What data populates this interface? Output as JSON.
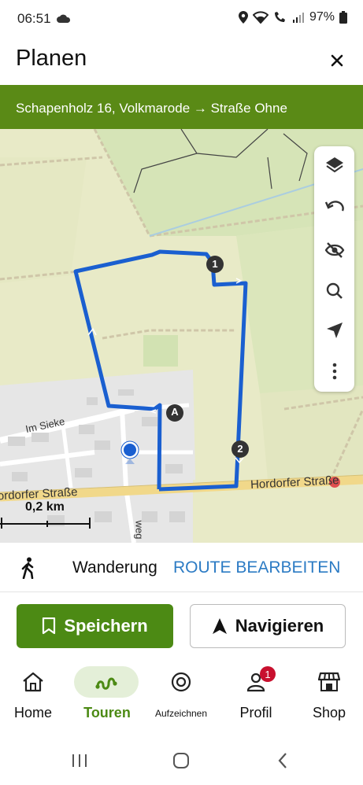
{
  "status": {
    "time": "06:51",
    "battery": "97%"
  },
  "header": {
    "title": "Planen"
  },
  "route": {
    "label": "Schapenholz 16, Volkmarode → Straße Ohne"
  },
  "map": {
    "streets": {
      "im_sieke": "Im Sieke",
      "hordorfer_left": "Hordorfer Straße",
      "hordorfer_right": "Hordorfer Straße",
      "weg": "weg"
    },
    "scale": "0,2 km",
    "markers": {
      "a": "A",
      "one": "1",
      "two": "2"
    },
    "route_color": "#1a5fd0"
  },
  "sheet": {
    "activity": "Wanderung",
    "edit_label": "ROUTE BEARBEITEN",
    "save_label": "Speichern",
    "navigate_label": "Navigieren"
  },
  "nav": {
    "items": [
      {
        "label": "Home"
      },
      {
        "label": "Touren"
      },
      {
        "label": "Aufzeichnen"
      },
      {
        "label": "Profil",
        "badge": "1"
      },
      {
        "label": "Shop"
      }
    ]
  },
  "colors": {
    "brand": "#5a8a16",
    "accent": "#2c7bc4"
  }
}
